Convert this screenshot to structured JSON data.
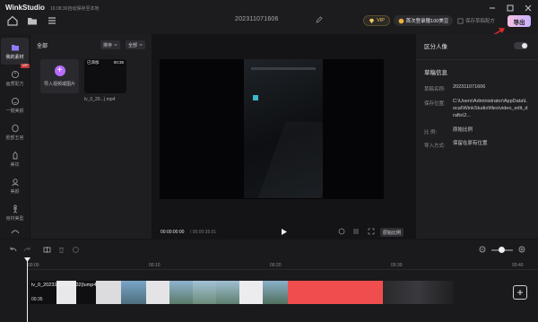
{
  "app": {
    "title": "WinkStudio",
    "subtitle": "16:08:30自动保存至本地",
    "project_name": "2023110716​06",
    "vip_label": "VIP",
    "promo_label": "首次登录赠100美豆",
    "save_draft_label": "保存草稿配方",
    "export_label": "导出"
  },
  "leftnav": {
    "items": [
      {
        "label": "我的素材",
        "icon": "folder-icon"
      },
      {
        "label": "画质配方",
        "icon": "palette-icon"
      },
      {
        "label": "一键美颜",
        "icon": "face-icon"
      },
      {
        "label": "脸部五官",
        "icon": "face-features-icon"
      },
      {
        "label": "美妆",
        "icon": "makeup-icon"
      },
      {
        "label": "美颜",
        "icon": "beauty-icon"
      },
      {
        "label": "身材美型",
        "icon": "body-icon"
      }
    ],
    "vip_tag": "VIP"
  },
  "media": {
    "tab_label": "全部",
    "sort_label": "排序",
    "filter_label": "全部",
    "import_label": "导入视频或图片",
    "clip": {
      "badge": "已添加",
      "duration": "00:35",
      "name": "lv_0_20...).mp4"
    }
  },
  "preview": {
    "time_current": "00:00:00:00",
    "time_total": "/ 00:00:35:01",
    "ratio_label": "原始比例"
  },
  "properties": {
    "section1_title": "区分人像",
    "section2_title": "草稿信息",
    "rows": [
      {
        "label": "草稿名称:",
        "value": "2023110716​06"
      },
      {
        "label": "保存位置:",
        "value": "C:\\Users\\Administrator\\AppData\\Local\\WinkStudio\\files\\video_edit_drafts\\2..."
      },
      {
        "label": "比    例:",
        "value": "原始比例"
      },
      {
        "label": "导入方式:",
        "value": "保留在原有位置"
      }
    ],
    "toggle_on": false
  },
  "timeline": {
    "ruler": [
      "00:00",
      "00:10",
      "00:20",
      "00:30",
      "00:40"
    ],
    "track_label": "lv_0_20231103174132(lump4",
    "track_duration": "00:35",
    "colors": {
      "accent_red": "#f04e4e",
      "playhead": "#f0f0f2"
    }
  }
}
